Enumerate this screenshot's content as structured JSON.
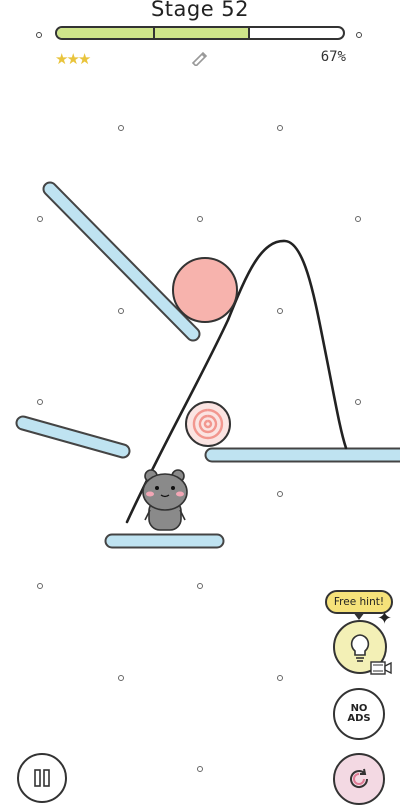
{
  "header": {
    "stage_title": "Stage 52",
    "progress_percent_text": "67%",
    "progress_fraction": 0.67,
    "stars": "★★★",
    "star_color": "#e9c43c",
    "progress_color": "#cfe58a"
  },
  "icons": {
    "pencil": "pencil-icon",
    "lightbulb": "lightbulb-icon",
    "video": "video-icon",
    "pause": "pause-icon",
    "restart": "restart-icon"
  },
  "hint": {
    "bubble_text": "Free hint!"
  },
  "no_ads": {
    "line1": "NO",
    "line2": "ADS"
  },
  "colors": {
    "platform": "#bfe3f1",
    "ball_pink": "#f7b3ad",
    "candy": "#f7c7c3",
    "bear": "#8a8a8a"
  }
}
